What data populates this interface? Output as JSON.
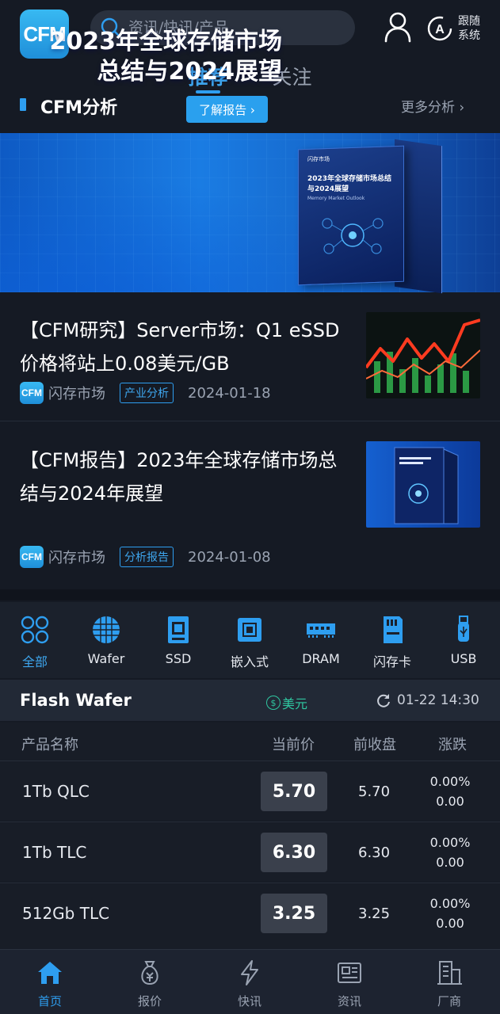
{
  "app": {
    "logo_text": "CFM"
  },
  "search": {
    "placeholder": "资讯/快讯/产品"
  },
  "header": {
    "follow_label": "跟随系统"
  },
  "feed_tabs": [
    {
      "label": "推荐",
      "active": true
    },
    {
      "label": "关注",
      "active": false
    }
  ],
  "section": {
    "title": "CFM分析",
    "more": "更多分析 ›"
  },
  "banner": {
    "title_line1": "2023年全球存储市场",
    "title_line2": "总结与2024展望",
    "button": "了解报告 ›",
    "book_logo": "闪存市场",
    "book_title": "2023年全球存储市场总结与2024展望",
    "book_subtitle": "Memory Market Outlook"
  },
  "news": [
    {
      "title": "【CFM研究】Server市场：Q1 eSSD 价格将站上0.08美元/GB",
      "source": "闪存市场",
      "tag": "产业分析",
      "date": "2024-01-18"
    },
    {
      "title": "【CFM报告】2023年全球存储市场总结与2024年展望",
      "source": "闪存市场",
      "tag": "分析报告",
      "date": "2024-01-08"
    }
  ],
  "categories": [
    {
      "label": "全部",
      "icon": "grid-icon",
      "active": true
    },
    {
      "label": "Wafer",
      "icon": "wafer-icon"
    },
    {
      "label": "SSD",
      "icon": "ssd-icon"
    },
    {
      "label": "嵌入式",
      "icon": "chip-icon"
    },
    {
      "label": "DRAM",
      "icon": "dram-icon"
    },
    {
      "label": "闪存卡",
      "icon": "sd-card-icon"
    },
    {
      "label": "USB",
      "icon": "usb-icon"
    }
  ],
  "price": {
    "title": "Flash Wafer",
    "currency": "美元",
    "currency_symbol": "$",
    "updated": "01-22 14:30",
    "columns": [
      "产品名称",
      "当前价",
      "前收盘",
      "涨跌"
    ],
    "rows": [
      {
        "name": "1Tb QLC",
        "current": "5.70",
        "prev": "5.70",
        "chg_pct": "0.00%",
        "chg": "0.00"
      },
      {
        "name": "1Tb TLC",
        "current": "6.30",
        "prev": "6.30",
        "chg_pct": "0.00%",
        "chg": "0.00"
      },
      {
        "name": "512Gb TLC",
        "current": "3.25",
        "prev": "3.25",
        "chg_pct": "0.00%",
        "chg": "0.00"
      }
    ]
  },
  "bottom_nav": [
    {
      "label": "首页",
      "icon": "home-icon",
      "active": true
    },
    {
      "label": "报价",
      "icon": "price-bag-icon"
    },
    {
      "label": "快讯",
      "icon": "flash-icon"
    },
    {
      "label": "资讯",
      "icon": "news-icon"
    },
    {
      "label": "厂商",
      "icon": "building-icon"
    }
  ],
  "colors": {
    "accent": "#2e9ef0",
    "currency": "#2fc6a0",
    "background": "#151a24"
  }
}
